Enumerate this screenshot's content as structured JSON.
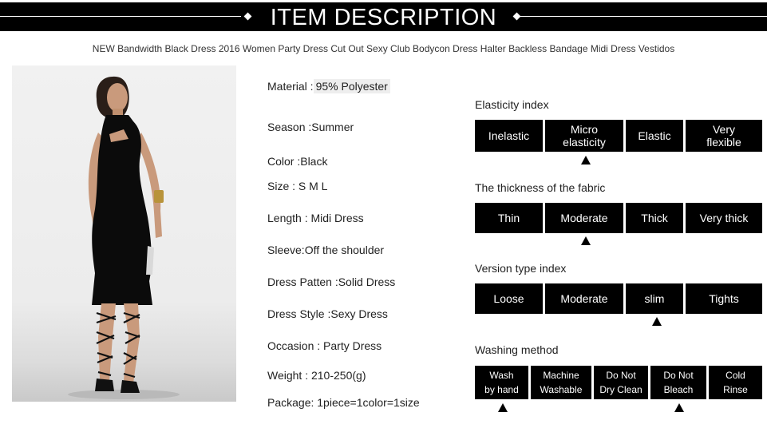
{
  "header": {
    "title": "ITEM DESCRIPTION"
  },
  "product_title": "NEW Bandwidth Black Dress 2016 Women Party Dress Cut Out Sexy Club Bodycon Dress Halter Backless Bandage Midi Dress Vestidos",
  "specs": {
    "material": {
      "label": "Material :",
      "value": "95% Polyester"
    },
    "season": "Season :Summer",
    "color": "Color :Black",
    "size": "Size : S M L",
    "length": "Length : Midi Dress",
    "sleeve": "Sleeve:Off the shoulder",
    "pattern": "Dress Patten :Solid Dress",
    "style": "Dress Style :Sexy Dress",
    "occasion": "Occasion : Party Dress",
    "weight": "Weight : 210-250(g)",
    "package": "Package: 1piece=1color=1size"
  },
  "elasticity": {
    "title": "Elasticity index",
    "options": [
      "Inelastic",
      "Micro\nelasticity",
      "Elastic",
      "Very\nflexible"
    ],
    "selected": "Micro elasticity"
  },
  "thickness": {
    "title": "The thickness of the fabric",
    "options": [
      "Thin",
      "Moderate",
      "Thick",
      "Very thick"
    ],
    "selected": "Moderate"
  },
  "version": {
    "title": "Version type index",
    "options": [
      "Loose",
      "Moderate",
      "slim",
      "Tights"
    ],
    "selected": "slim"
  },
  "washing": {
    "title": "Washing method",
    "options": [
      "Wash\nby hand",
      "Machine\nWashable",
      "Do Not\nDry Clean",
      "Do Not\nBleach",
      "Cold\nRinse"
    ],
    "selected": [
      "Wash by hand",
      "Do Not Bleach"
    ]
  },
  "colors": {
    "bar": "#000000",
    "text_on_bar": "#ffffff",
    "background": "#ffffff"
  },
  "icons": {
    "marker": "triangle-up-icon"
  }
}
